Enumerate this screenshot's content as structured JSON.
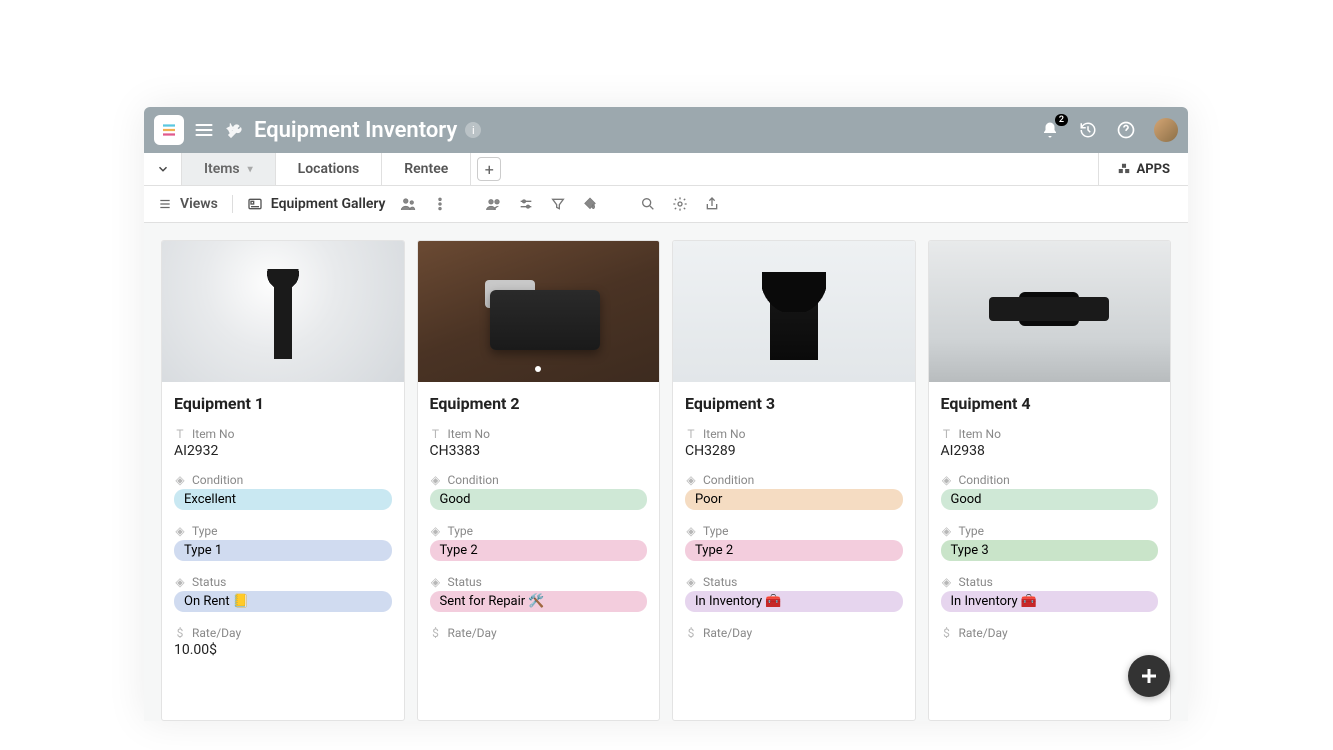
{
  "header": {
    "title": "Equipment Inventory",
    "notifications_count": "2"
  },
  "tabs": {
    "items_label": "Items",
    "locations_label": "Locations",
    "rentee_label": "Rentee",
    "apps_label": "APPS"
  },
  "toolbar": {
    "views_label": "Views",
    "view_name": "Equipment Gallery"
  },
  "field_labels": {
    "item_no": "Item No",
    "condition": "Condition",
    "type": "Type",
    "status": "Status",
    "rate": "Rate/Day"
  },
  "cards": [
    {
      "title": "Equipment 1",
      "item_no": "AI2932",
      "condition": "Excellent",
      "condition_bg": "#c9e8f2",
      "type": "Type 1",
      "type_bg": "#d0dbf0",
      "status": "On Rent 📒",
      "status_bg": "#d0dbf0",
      "rate": "10.00$"
    },
    {
      "title": "Equipment 2",
      "item_no": "CH3383",
      "condition": "Good",
      "condition_bg": "#cfe8d6",
      "type": "Type 2",
      "type_bg": "#f3cddd",
      "status": "Sent for Repair 🛠️",
      "status_bg": "#f3cddd",
      "rate": ""
    },
    {
      "title": "Equipment 3",
      "item_no": "CH3289",
      "condition": "Poor",
      "condition_bg": "#f5dcc2",
      "type": "Type 2",
      "type_bg": "#f3cddd",
      "status": "In Inventory 🧰",
      "status_bg": "#e6d5ee",
      "rate": ""
    },
    {
      "title": "Equipment 4",
      "item_no": "AI2938",
      "condition": "Good",
      "condition_bg": "#cfe8d6",
      "type": "Type 3",
      "type_bg": "#c9e4c9",
      "status": "In Inventory 🧰",
      "status_bg": "#e6d5ee",
      "rate": ""
    }
  ]
}
